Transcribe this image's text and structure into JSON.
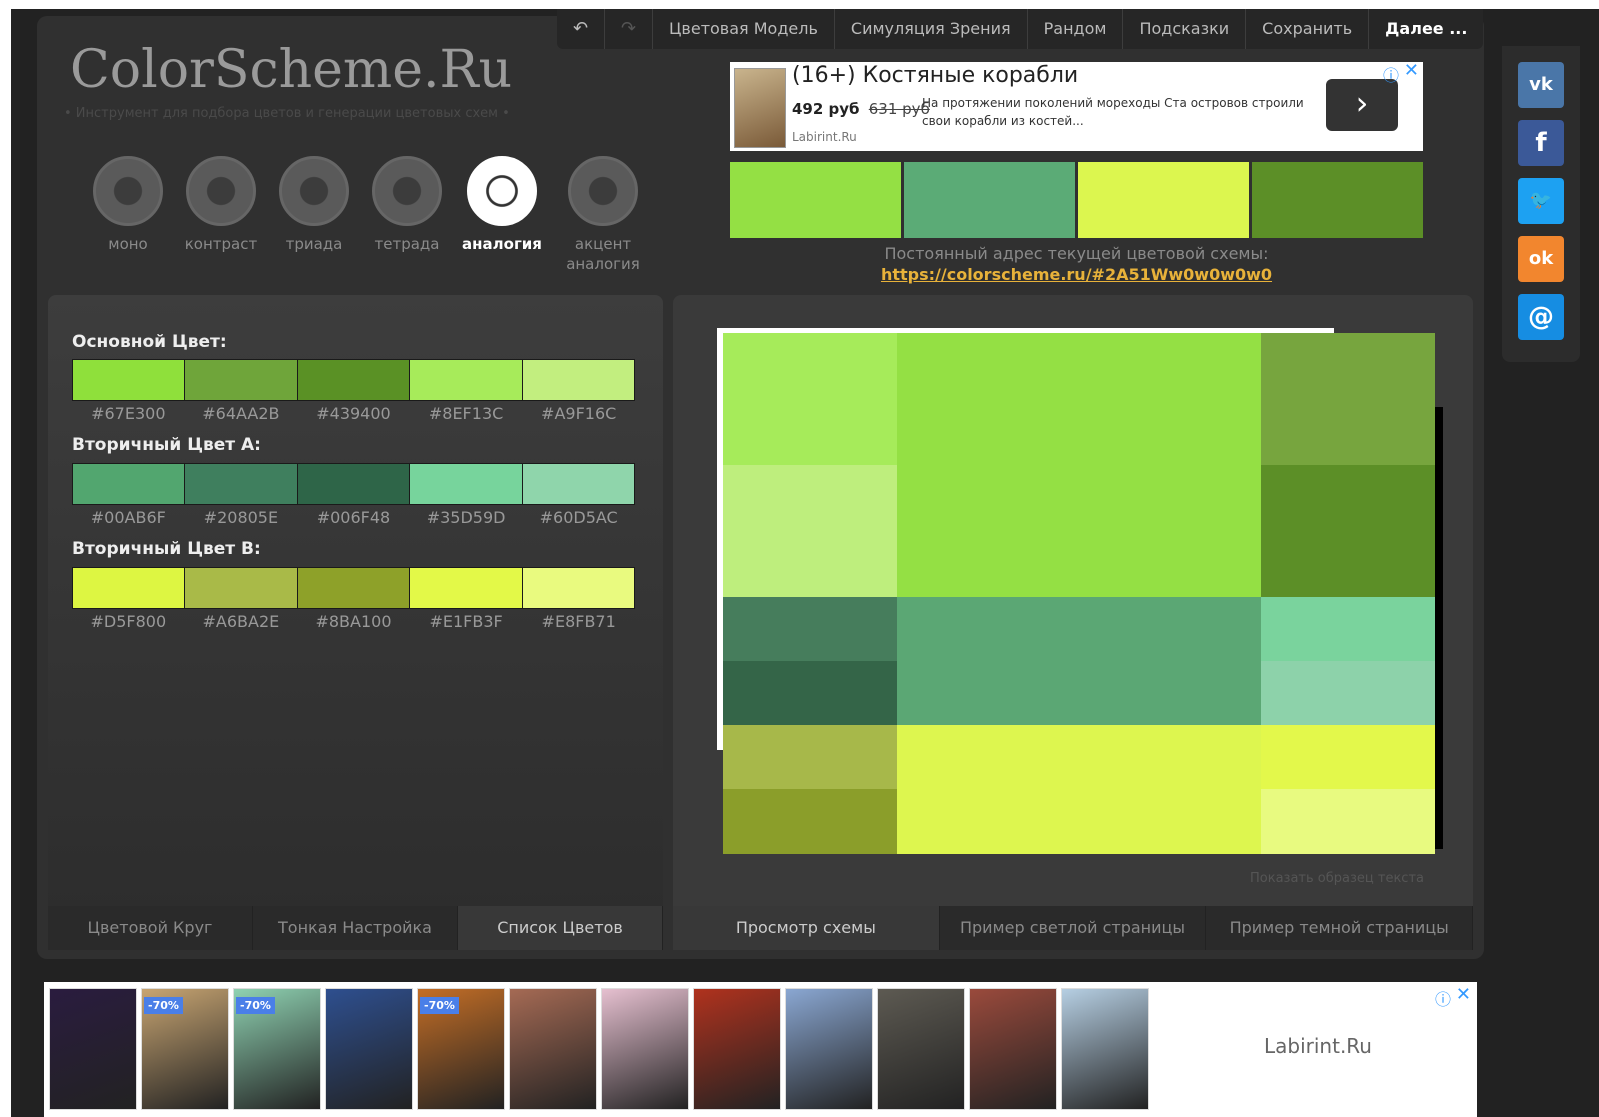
{
  "nav": {
    "undo_icon": "↶",
    "redo_icon": "↷",
    "items": [
      "Цветовая Модель",
      "Симуляция Зрения",
      "Рандом",
      "Подсказки",
      "Сохранить",
      "Далее ..."
    ]
  },
  "logo": {
    "title": "ColorScheme.Ru",
    "tagline": "• Инструмент для подбора цветов и генерации цветовых схем •"
  },
  "wheels": [
    {
      "label": "моно",
      "active": false
    },
    {
      "label": "контраст",
      "active": false
    },
    {
      "label": "триада",
      "active": false
    },
    {
      "label": "тетрада",
      "active": false
    },
    {
      "label": "аналогия",
      "active": true
    },
    {
      "label": "акцент аналогия",
      "active": false
    }
  ],
  "ad_top": {
    "title": "(16+) Костяные корабли",
    "price": "492 руб",
    "old_price": "631 руб",
    "description": "На протяжении поколений мореходы Ста островов строили свои корабли из костей...",
    "source": "Labirint.Ru",
    "go_icon": "›",
    "info_icon": "ⓘ",
    "close_icon": "✕"
  },
  "strip_colors": [
    "#94E044",
    "#5BAB76",
    "#DCF64F",
    "#5C8F27"
  ],
  "permalink": {
    "label": "Постоянный адрес текущей цветовой схемы:",
    "url": "https://colorscheme.ru/#2A51Ww0w0w0w0"
  },
  "groups": [
    {
      "title": "Основной Цвет:",
      "hexes": [
        "#67E300",
        "#64AA2B",
        "#439400",
        "#8EF13C",
        "#A9F16C"
      ],
      "swatches": [
        "#8FE03B",
        "#6FA53A",
        "#5A9125",
        "#A7EB5A",
        "#C2EE7F"
      ]
    },
    {
      "title": "Вторичный Цвет А:",
      "hexes": [
        "#00AB6F",
        "#20805E",
        "#006F48",
        "#35D59D",
        "#60D5AC"
      ],
      "swatches": [
        "#52A66F",
        "#3F7F5E",
        "#2E6548",
        "#77D49C",
        "#8FD5AB"
      ]
    },
    {
      "title": "Вторичный Цвет В:",
      "hexes": [
        "#D5F800",
        "#A6BA2E",
        "#8BA100",
        "#E1FB3F",
        "#E8FB71"
      ],
      "swatches": [
        "#DDF642",
        "#A9BA48",
        "#8EA129",
        "#E3F948",
        "#E9FA7F"
      ]
    }
  ],
  "left_tabs": [
    "Цветовой Круг",
    "Тонкая Настройка",
    "Список Цветов"
  ],
  "preview": {
    "cells": [
      {
        "color": "#A6EB5A",
        "col": "1",
        "row": "1 / span 2"
      },
      {
        "color": "#94E044",
        "col": "2",
        "row": "1 / span 4"
      },
      {
        "color": "#77A53E",
        "col": "3",
        "row": "1 / span 2"
      },
      {
        "color": "#BEEE7D",
        "col": "1",
        "row": "3 / span 2"
      },
      {
        "color": "#5C8F27",
        "col": "3",
        "row": "3 / span 2"
      },
      {
        "color": "#467D5C",
        "col": "1",
        "row": "5"
      },
      {
        "color": "#5BA774",
        "col": "2",
        "row": "5 / span 2"
      },
      {
        "color": "#7AD39D",
        "col": "3",
        "row": "5"
      },
      {
        "color": "#346548",
        "col": "1",
        "row": "6"
      },
      {
        "color": "#8DD2AA",
        "col": "3",
        "row": "6"
      },
      {
        "color": "#A7B84A",
        "col": "1",
        "row": "7"
      },
      {
        "color": "#DDF64F",
        "col": "2",
        "row": "7 / span 2"
      },
      {
        "color": "#E3F84B",
        "col": "3",
        "row": "7"
      },
      {
        "color": "#8B9E2A",
        "col": "1",
        "row": "8"
      },
      {
        "color": "#E8FA80",
        "col": "3",
        "row": "8"
      }
    ],
    "show_text": "Показать образец текста"
  },
  "right_tabs": [
    "Просмотр схемы",
    "Пример светлой страницы",
    "Пример темной страницы"
  ],
  "social": [
    {
      "name": "vk-icon",
      "glyph": "vk",
      "color": "#4a76a8"
    },
    {
      "name": "facebook-icon",
      "glyph": "f",
      "color": "#3b5998"
    },
    {
      "name": "twitter-icon",
      "glyph": "🐦",
      "color": "#1da1f2"
    },
    {
      "name": "odnoklassniki-icon",
      "glyph": "ok",
      "color": "#f2862e"
    },
    {
      "name": "mailru-icon",
      "glyph": "@",
      "color": "#168de2"
    }
  ],
  "ad_bottom": {
    "brand": "Labirint.Ru",
    "info_icon": "ⓘ",
    "close_icon": "✕",
    "books": [
      {
        "color": "#2a1c3f",
        "badge": ""
      },
      {
        "color": "#c8a572",
        "badge": "-70%"
      },
      {
        "color": "#8fd2b2",
        "badge": "-70%"
      },
      {
        "color": "#2e4f8f",
        "badge": ""
      },
      {
        "color": "#c46e26",
        "badge": "-70%"
      },
      {
        "color": "#a56a54",
        "badge": ""
      },
      {
        "color": "#e6c0d0",
        "badge": ""
      },
      {
        "color": "#b0321e",
        "badge": ""
      },
      {
        "color": "#8aa7d2",
        "badge": ""
      },
      {
        "color": "#5d5a52",
        "badge": ""
      },
      {
        "color": "#9a4a3c",
        "badge": ""
      },
      {
        "color": "#b6cfe3",
        "badge": ""
      }
    ]
  }
}
